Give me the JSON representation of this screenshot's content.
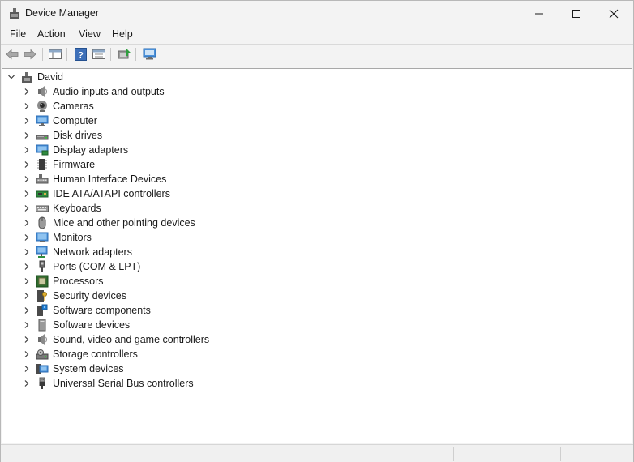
{
  "window": {
    "title": "Device Manager"
  },
  "menu": {
    "file": "File",
    "action": "Action",
    "view": "View",
    "help": "Help"
  },
  "toolbar": {
    "buttons": [
      "back-icon",
      "forward-icon",
      "show-hide-console-tree-icon",
      "help-icon",
      "properties-icon",
      "update-driver-icon",
      "scan-hardware-icon"
    ]
  },
  "tree": {
    "root": "David",
    "categories": [
      "Audio inputs and outputs",
      "Cameras",
      "Computer",
      "Disk drives",
      "Display adapters",
      "Firmware",
      "Human Interface Devices",
      "IDE ATA/ATAPI controllers",
      "Keyboards",
      "Mice and other pointing devices",
      "Monitors",
      "Network adapters",
      "Ports (COM & LPT)",
      "Processors",
      "Security devices",
      "Software components",
      "Software devices",
      "Sound, video and game controllers",
      "Storage controllers",
      "System devices",
      "Universal Serial Bus controllers"
    ]
  },
  "colors": {
    "accent": "#1f7fd6",
    "background": "#f3f3f3",
    "tree_bg": "#ffffff"
  }
}
